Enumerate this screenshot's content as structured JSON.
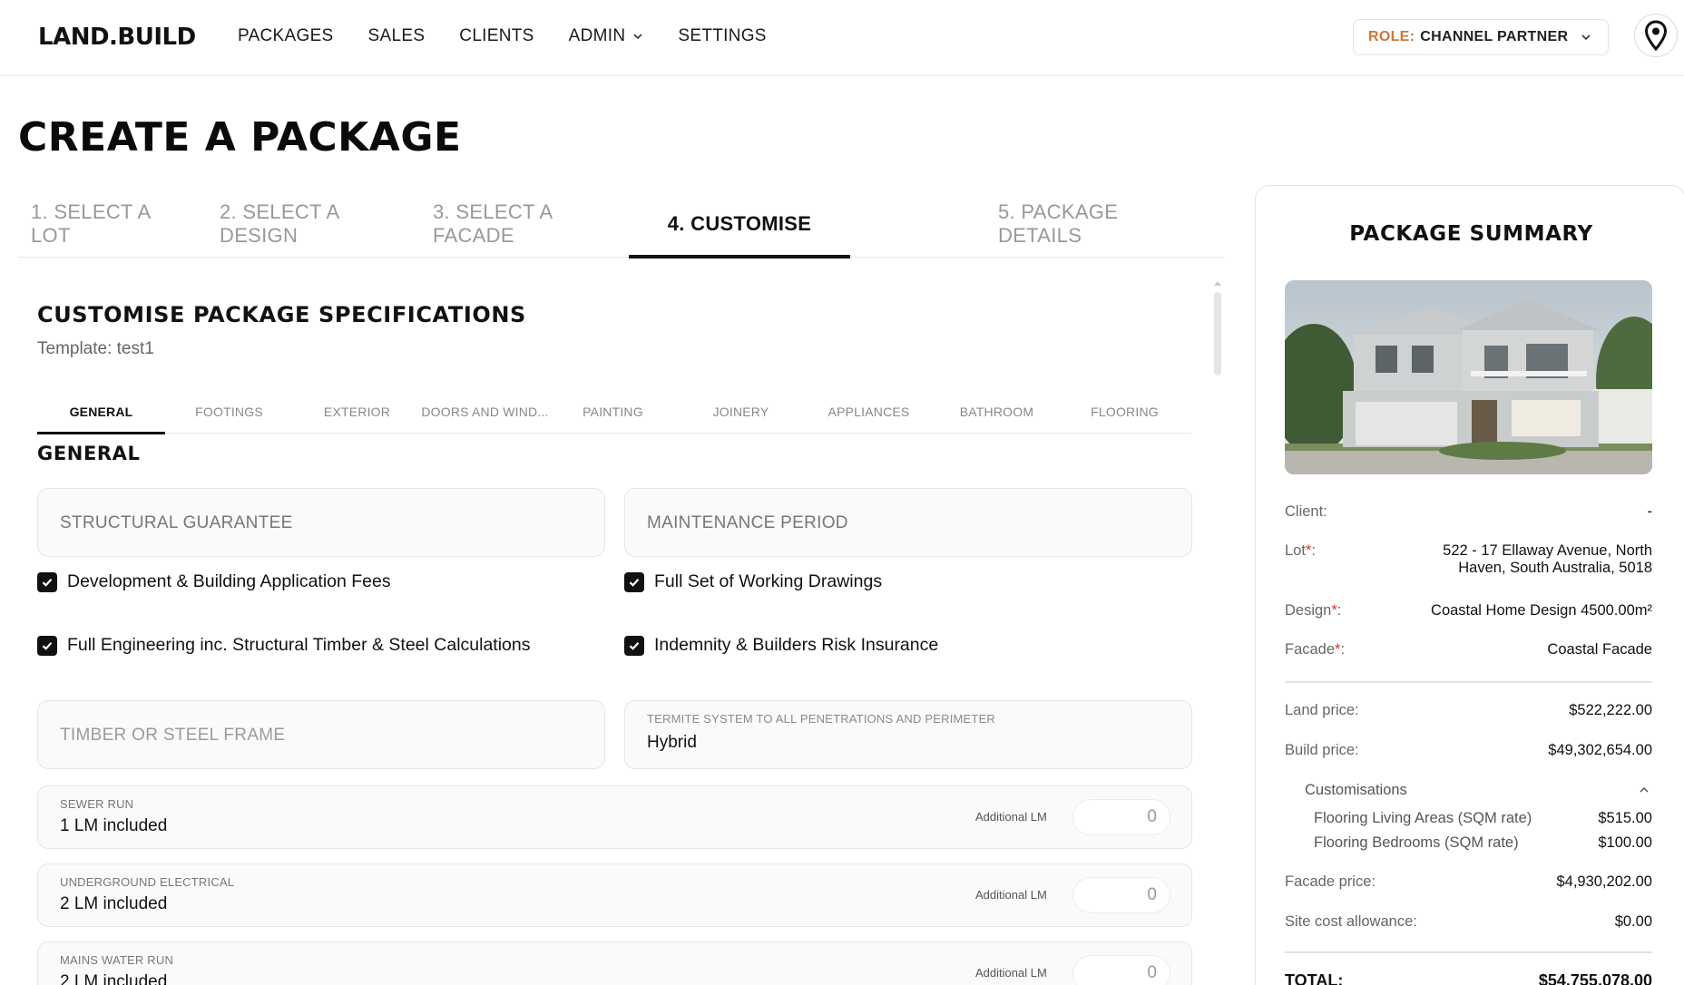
{
  "app": {
    "logo": "LAND.BUILD",
    "nav": [
      "PACKAGES",
      "SALES",
      "CLIENTS",
      "ADMIN",
      "SETTINGS"
    ],
    "role_key": "ROLE:",
    "role_value": "CHANNEL PARTNER"
  },
  "page": {
    "title": "CREATE A PACKAGE",
    "steps": [
      "1. SELECT A LOT",
      "2. SELECT A DESIGN",
      "3. SELECT A FACADE",
      "4. CUSTOMISE",
      "5. PACKAGE DETAILS"
    ],
    "active_step": "4. CUSTOMISE"
  },
  "customise": {
    "title": "CUSTOMISE PACKAGE SPECIFICATIONS",
    "template": "Template: test1",
    "tabs": [
      "GENERAL",
      "FOOTINGS",
      "EXTERIOR",
      "DOORS AND WIND...",
      "PAINTING",
      "JOINERY",
      "APPLIANCES",
      "BATHROOM",
      "FLOORING"
    ],
    "active_tab": "GENERAL",
    "group_title": "GENERAL",
    "fields": {
      "structural_guarantee": "STRUCTURAL GUARANTEE",
      "maintenance_period": "MAINTENANCE PERIOD",
      "frame": "TIMBER OR STEEL FRAME",
      "termite_label": "TERMITE SYSTEM TO ALL PENETRATIONS AND PERIMETER",
      "termite_value": "Hybrid"
    },
    "checkboxes": [
      "Development & Building Application Fees",
      "Full Set of Working Drawings",
      "Full Engineering inc. Structural Timber & Steel Calculations",
      "Indemnity & Builders Risk Insurance"
    ],
    "lm_rows": [
      {
        "label": "SEWER RUN",
        "value": "1 LM included",
        "additional_label": "Additional LM",
        "additional_value": "0"
      },
      {
        "label": "UNDERGROUND ELECTRICAL",
        "value": "2 LM included",
        "additional_label": "Additional LM",
        "additional_value": "0"
      },
      {
        "label": "MAINS WATER RUN",
        "value": "2 LM included",
        "additional_label": "Additional LM",
        "additional_value": "0"
      }
    ]
  },
  "summary": {
    "title": "PACKAGE SUMMARY",
    "image_caption": "Coastal Facade",
    "client_label": "Client:",
    "client_value": "-",
    "lot_label": "Lot",
    "lot_value_1": "522 - 17 Ellaway Avenue, North",
    "lot_value_2": "Haven, South Australia, 5018",
    "design_label": "Design",
    "design_value": "Coastal Home Design 4500.00m²",
    "facade_label": "Facade",
    "facade_value": "Coastal Facade",
    "land_label": "Land price:",
    "land_value": "$522,222.00",
    "build_label": "Build price:",
    "build_value": "$49,302,654.00",
    "customisations_label": "Customisations",
    "customisations": [
      {
        "name": "Flooring Living Areas (SQM rate)",
        "price": "$515.00"
      },
      {
        "name": "Flooring Bedrooms (SQM rate)",
        "price": "$100.00"
      }
    ],
    "facade_price_label": "Facade price:",
    "facade_price_value": "$4,930,202.00",
    "site_label": "Site cost allowance:",
    "site_value": "$0.00",
    "total_label": "TOTAL:",
    "total_value": "$54,755,078.00"
  }
}
